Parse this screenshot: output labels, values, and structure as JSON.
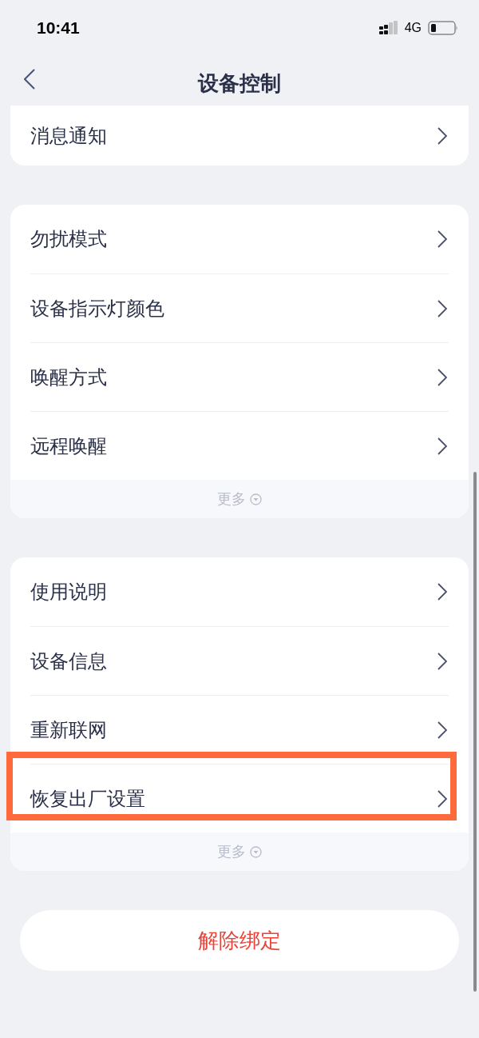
{
  "status_bar": {
    "time": "10:41",
    "network": "4G"
  },
  "nav": {
    "title": "设备控制"
  },
  "sections": [
    {
      "items": [
        {
          "label": "消息通知",
          "highlighted": false
        }
      ]
    },
    {
      "items": [
        {
          "label": "勿扰模式",
          "highlighted": false
        },
        {
          "label": "设备指示灯颜色",
          "highlighted": false
        },
        {
          "label": "唤醒方式",
          "highlighted": false
        },
        {
          "label": "远程唤醒",
          "highlighted": false
        }
      ],
      "more": "更多"
    },
    {
      "items": [
        {
          "label": "使用说明",
          "highlighted": false
        },
        {
          "label": "设备信息",
          "highlighted": false
        },
        {
          "label": "重新联网",
          "highlighted": false
        },
        {
          "label": "恢复出厂设置",
          "highlighted": true
        }
      ],
      "more": "更多"
    }
  ],
  "unbind_button": "解除绑定"
}
